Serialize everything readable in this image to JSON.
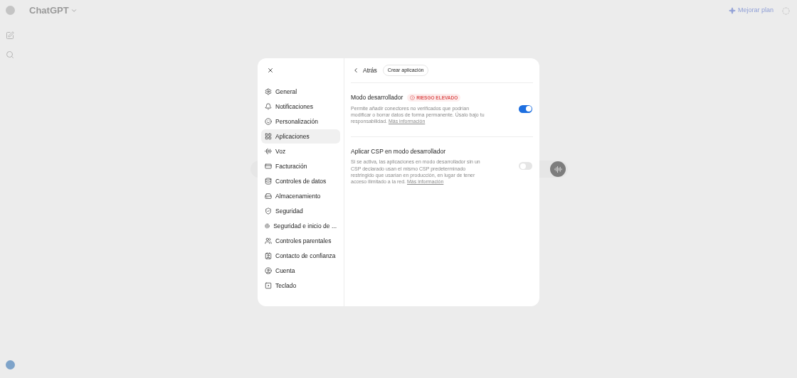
{
  "header": {
    "title": "ChatGPT",
    "upgrade": "Mejorar plan"
  },
  "settings": {
    "nav": [
      {
        "label": "General",
        "selected": false
      },
      {
        "label": "Notificaciones",
        "selected": false
      },
      {
        "label": "Personalización",
        "selected": false
      },
      {
        "label": "Aplicaciones",
        "selected": true
      },
      {
        "label": "Voz",
        "selected": false
      },
      {
        "label": "Facturación",
        "selected": false
      },
      {
        "label": "Controles de datos",
        "selected": false
      },
      {
        "label": "Almacenamiento",
        "selected": false
      },
      {
        "label": "Seguridad",
        "selected": false
      },
      {
        "label": "Seguridad e inicio de ...",
        "selected": false
      },
      {
        "label": "Controles parentales",
        "selected": false
      },
      {
        "label": "Contacto de confianza",
        "selected": false
      },
      {
        "label": "Cuenta",
        "selected": false
      },
      {
        "label": "Teclado",
        "selected": false
      }
    ],
    "back": "Atrás",
    "create": "Crear aplicación",
    "options": [
      {
        "title": "Modo desarrollador",
        "badge": "RIESGO ELEVADO",
        "description": "Permite añadir conectores no verificados que podrían modificar o borrar datos de forma permanente. Úsalo bajo tu responsabilidad.",
        "link": "Más información",
        "on": true
      },
      {
        "title": "Aplicar CSP en modo desarrollador",
        "description": "Si se activa, las aplicaciones en modo desarrollador sin un CSP declarado usan el mismo CSP predeterminado restringido que usarían en producción, en lugar de tener acceso ilimitado a la red.",
        "link": "Más información",
        "on": false
      }
    ]
  }
}
